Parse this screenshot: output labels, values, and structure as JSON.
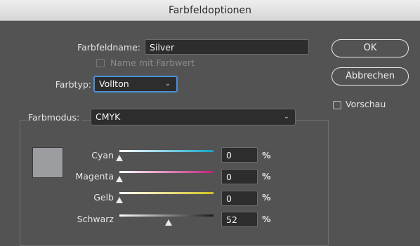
{
  "window": {
    "title": "Farbfeldoptionen"
  },
  "swatch_name": {
    "label": "Farbfeldname:",
    "value": "Silver"
  },
  "name_with_value": {
    "label": "Name mit Farbwert",
    "checked": false
  },
  "color_type": {
    "label": "Farbtyp:",
    "value": "Vollton"
  },
  "color_mode": {
    "label": "Farbmodus:",
    "value": "CMYK"
  },
  "preview_color": "#9b9da0",
  "channels": [
    {
      "name": "Cyan",
      "value": "0",
      "unit": "%",
      "level": 0,
      "track_color": "#12a3c9"
    },
    {
      "name": "Magenta",
      "value": "0",
      "unit": "%",
      "level": 0,
      "track_color": "#c0207a"
    },
    {
      "name": "Gelb",
      "value": "0",
      "unit": "%",
      "level": 0,
      "track_color": "#d1c21e"
    },
    {
      "name": "Schwarz",
      "value": "52",
      "unit": "%",
      "level": 0.52,
      "track_color": "#1a1a1a"
    }
  ],
  "buttons": {
    "ok": "OK",
    "cancel": "Abbrechen"
  },
  "preview": {
    "label": "Vorschau",
    "checked": false
  }
}
